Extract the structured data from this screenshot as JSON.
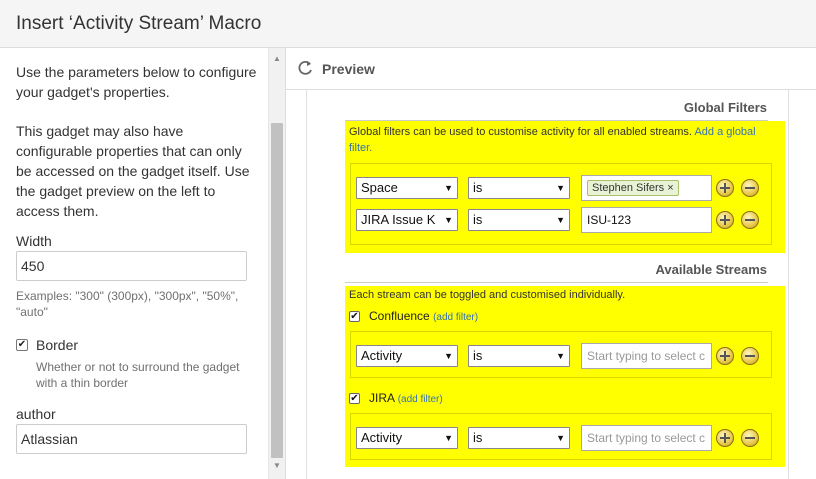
{
  "dialog": {
    "title": "Insert ‘Activity Stream’ Macro"
  },
  "left": {
    "intro": "Use the parameters below to configure your gadget's properties.",
    "note": "This gadget may also have configurable properties that can only be accessed on the gadget itself. Use the gadget preview on the left to access them.",
    "width": {
      "label": "Width",
      "value": "450",
      "help": "Examples: \"300\" (300px), \"300px\", \"50%\", \"auto\""
    },
    "border": {
      "label": "Border",
      "checked": true,
      "help": "Whether or not to surround the gadget with a thin border"
    },
    "author": {
      "label": "author",
      "value": "Atlassian"
    }
  },
  "preview": {
    "title": "Preview",
    "global_filters": {
      "heading": "Global Filters",
      "description": "Global filters can be used to customise activity for all enabled streams.",
      "add_link": "Add a global filter.",
      "rows": [
        {
          "field": "Space",
          "operator": "is",
          "tag": "Stephen Sifers",
          "tag_remove": "×"
        },
        {
          "field": "JIRA Issue K",
          "operator": "is",
          "value": "ISU-123"
        }
      ]
    },
    "available_streams": {
      "heading": "Available Streams",
      "description": "Each stream can be toggled and customised individually.",
      "streams": [
        {
          "name": "Confluence",
          "checked": true,
          "add_filter": "(add filter)",
          "filter": {
            "field": "Activity",
            "operator": "is",
            "placeholder": "Start typing to select c"
          }
        },
        {
          "name": "JIRA",
          "checked": true,
          "add_filter": "(add filter)",
          "filter": {
            "field": "Activity",
            "operator": "is",
            "placeholder": "Start typing to select c"
          }
        }
      ]
    }
  },
  "icons": {
    "refresh": "refresh-icon",
    "checkmark": "✔",
    "caret": "▼",
    "scroll_up": "▲",
    "scroll_down": "▼"
  },
  "colors": {
    "highlight": "#ffff00",
    "link": "#3572b0"
  }
}
